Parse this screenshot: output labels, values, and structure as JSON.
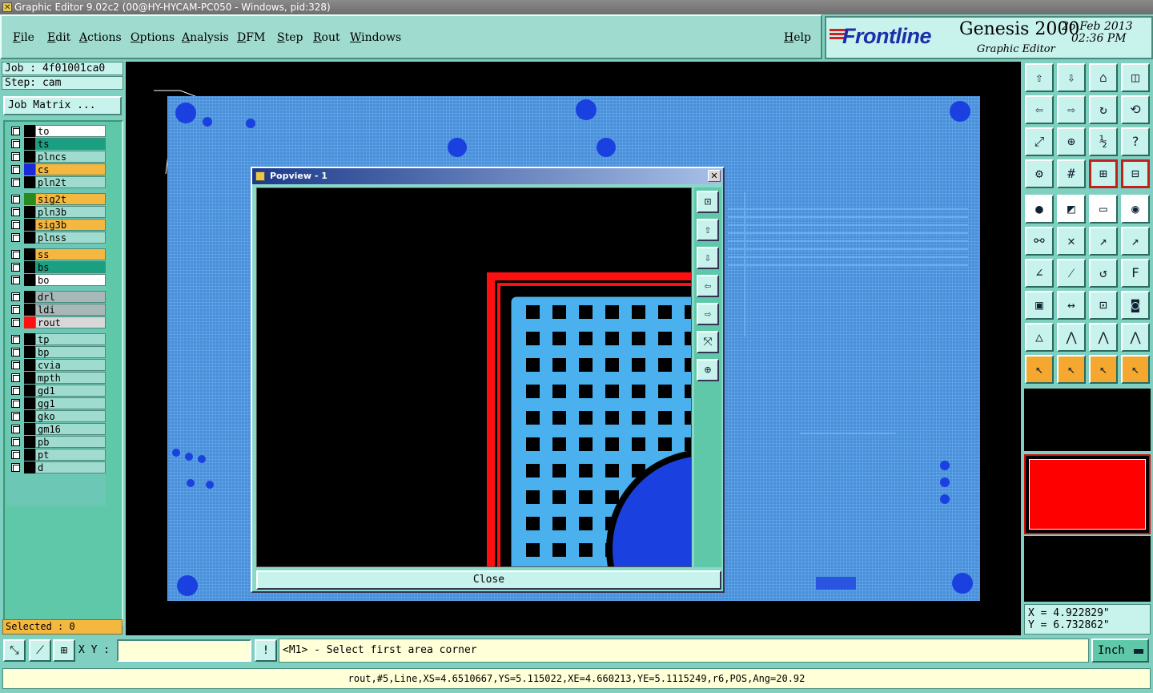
{
  "window": {
    "title": "Graphic Editor 9.02c2 (00@HY-HYCAM-PC050 - Windows, pid:328)"
  },
  "menu": {
    "items": [
      "File",
      "Edit",
      "Actions",
      "Options",
      "Analysis",
      "DFM",
      "Step",
      "Rout",
      "Windows"
    ],
    "help": "Help"
  },
  "brand": {
    "logo": "Frontline",
    "product": "Genesis 2000",
    "subtitle": "Graphic Editor",
    "date": "26 Feb 2013",
    "time": "02:36 PM"
  },
  "job": {
    "job_line": "Job : 4f01001ca0",
    "step_line": "Step: cam",
    "matrix_button": "Job Matrix ..."
  },
  "layers": [
    {
      "name": "to",
      "color": "#ffffff"
    },
    {
      "name": "ts",
      "color": "#1aa080"
    },
    {
      "name": "plncs",
      "color": "#9fdccf"
    },
    {
      "name": "cs",
      "color": "#f4b840",
      "swatch": "#1a2ad8"
    },
    {
      "name": "pln2t",
      "color": "#9fdccf"
    },
    {
      "name": "sig2t",
      "color": "#f4b840",
      "swatch": "#2a8a20"
    },
    {
      "name": "pln3b",
      "color": "#9fdccf"
    },
    {
      "name": "sig3b",
      "color": "#f4b840"
    },
    {
      "name": "plnss",
      "color": "#9fdccf"
    },
    {
      "name": "ss",
      "color": "#f4b840"
    },
    {
      "name": "bs",
      "color": "#1aa080"
    },
    {
      "name": "bo",
      "color": "#ffffff"
    },
    {
      "name": "drl",
      "color": "#a8b8b8"
    },
    {
      "name": "ldi",
      "color": "#a8b8b8"
    },
    {
      "name": "rout",
      "color": "#d8d8d8",
      "swatch": "#ff1010"
    },
    {
      "name": "tp",
      "color": "#9fdccf"
    },
    {
      "name": "bp",
      "color": "#9fdccf"
    },
    {
      "name": "cvia",
      "color": "#9fdccf"
    },
    {
      "name": "mpth",
      "color": "#9fdccf"
    },
    {
      "name": "gd1",
      "color": "#9fdccf"
    },
    {
      "name": "gg1",
      "color": "#9fdccf"
    },
    {
      "name": "gko",
      "color": "#9fdccf"
    },
    {
      "name": "gm16",
      "color": "#9fdccf"
    },
    {
      "name": "pb",
      "color": "#9fdccf"
    },
    {
      "name": "pt",
      "color": "#9fdccf"
    },
    {
      "name": "d",
      "color": "#9fdccf"
    }
  ],
  "selected": "Selected : 0",
  "popview": {
    "title": "Popview - 1",
    "close_button": "Close",
    "close_x": "✕"
  },
  "coords": {
    "x": "X  =  4.922829\"",
    "y": "Y  =  6.732862\""
  },
  "command": {
    "xy_label": "X Y :",
    "xy_value": "",
    "prompt": "<M1> - Select first area corner",
    "units": "Inch",
    "alert": "!"
  },
  "status": "rout,#5,Line,XS=4.6510667,YS=5.115022,XE=4.660213,YE=5.1115249,r6,POS,Ang=20.92",
  "colors": {
    "accent": "#7fd0c0",
    "board": "#4a8fd8",
    "rout": "#ff0000"
  }
}
